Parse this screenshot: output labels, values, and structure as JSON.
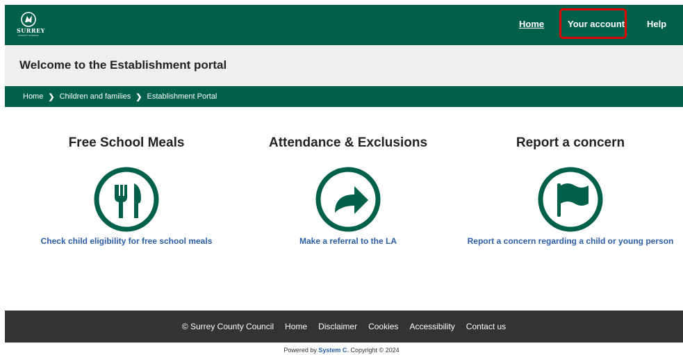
{
  "header": {
    "logo_brand": "SURREY",
    "logo_sub": "COUNTY COUNCIL",
    "nav": {
      "home": "Home",
      "account": "Your account",
      "help": "Help"
    }
  },
  "welcome": {
    "title": "Welcome to the Establishment portal"
  },
  "breadcrumb": [
    "Home",
    "Children and families",
    "Establishment Portal"
  ],
  "tiles": [
    {
      "title": "Free School Meals",
      "icon": "cutlery-icon",
      "link": "Check child eligibility for free school meals"
    },
    {
      "title": "Attendance & Exclusions",
      "icon": "arrow-right-icon",
      "link": "Make a referral to the LA"
    },
    {
      "title": "Report a concern",
      "icon": "flag-icon",
      "link": "Report a concern regarding a child or young person"
    }
  ],
  "footer": {
    "copyright": "© Surrey County Council",
    "links": [
      "Home",
      "Disclaimer",
      "Cookies",
      "Accessibility",
      "Contact us"
    ]
  },
  "powered": {
    "prefix": "Powered by",
    "brand": "System C",
    "suffix": ". Copyright © 2024"
  },
  "colors": {
    "brand_green": "#00604a",
    "link_blue": "#2b5da8",
    "highlight_red": "#e00000",
    "footer_dark": "#333333"
  }
}
